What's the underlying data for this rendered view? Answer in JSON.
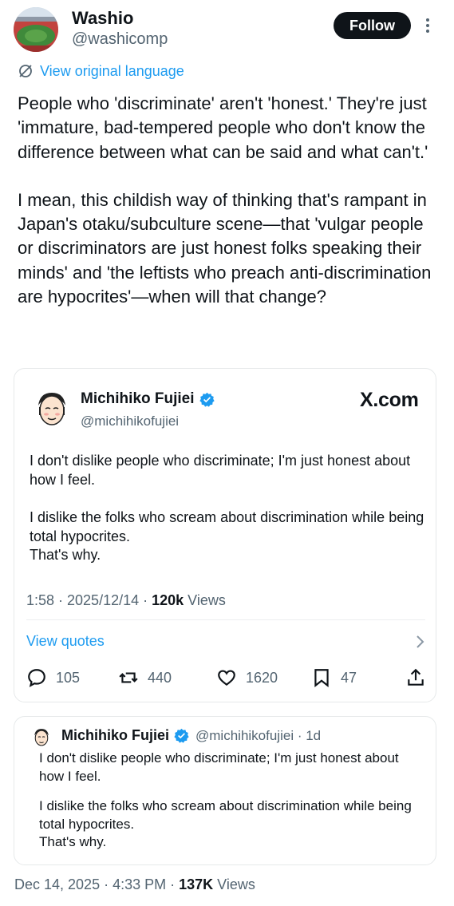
{
  "author": {
    "name": "Washio",
    "handle": "@washicomp",
    "follow_label": "Follow"
  },
  "translate": {
    "label": "View original language"
  },
  "tweet": {
    "paragraphs": [
      "People who 'discriminate' aren't 'honest.' They're just 'immature, bad-tempered people who don't know the difference between what can be said and what can't.'",
      "I mean, this childish way of thinking that's rampant in Japan's otaku/subculture scene—that 'vulgar people or discriminators are just honest folks speaking their minds' and 'the leftists who preach anti-discrimination are hypocrites'—when will that change?"
    ]
  },
  "embed": {
    "name": "Michihiko Fujiei",
    "handle": "@michihikofujiei",
    "logo": "X.com",
    "paragraphs": [
      "I don't dislike people who discriminate; I'm just honest about how I feel.",
      "I dislike the folks who scream about discrimination while being total hypocrites.\nThat's why."
    ],
    "time": "1:58 · 2025/12/14 · ",
    "views_count": "120k",
    "views_label": " Views",
    "view_quotes_label": "View quotes",
    "actions": {
      "replies": "105",
      "retweets": "440",
      "likes": "1620",
      "bookmarks": "47"
    }
  },
  "quote": {
    "name": "Michihiko Fujiei",
    "handle_time": "@michihikofujiei · 1d",
    "paragraphs": [
      "I don't dislike people who discriminate; I'm just honest about how I feel.",
      "I dislike the folks who scream about discrimination while being total hypocrites.\nThat's why."
    ]
  },
  "footer": {
    "timestamp": "Dec 14, 2025 · 4:33 PM · ",
    "views_count": "137K",
    "views_label": " Views"
  },
  "colors": {
    "accent": "#1d9bf0",
    "text": "#0f1419",
    "muted": "#536471",
    "border": "#e6e9ea"
  },
  "icons": {
    "more": "more-vertical-icon",
    "translate": "translate-icon",
    "verified": "verified-badge-icon",
    "reply": "reply-icon",
    "retweet": "retweet-icon",
    "like": "heart-icon",
    "bookmark": "bookmark-icon",
    "share": "share-icon",
    "chevron": "chevron-right-icon"
  }
}
